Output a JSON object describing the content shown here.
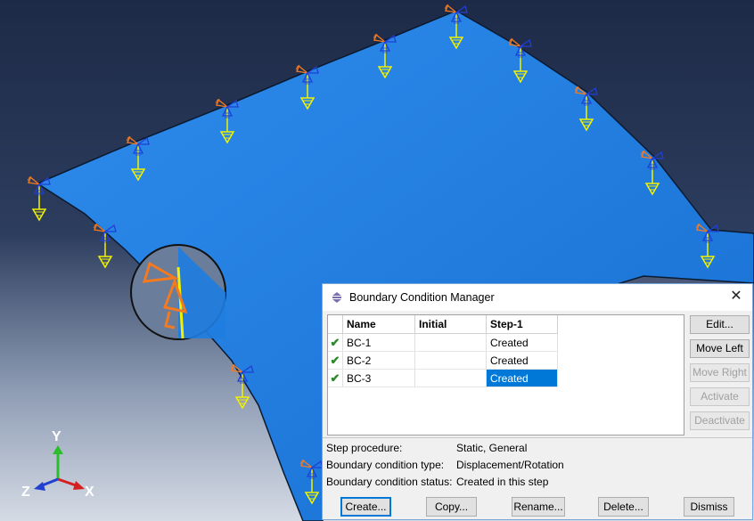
{
  "dialog": {
    "title": "Boundary Condition Manager",
    "close_label": "✕",
    "table": {
      "headers": [
        "Name",
        "Initial",
        "Step-1"
      ],
      "rows": [
        {
          "status": "✔",
          "name": "BC-1",
          "initial": "",
          "step1": "Created"
        },
        {
          "status": "✔",
          "name": "BC-2",
          "initial": "",
          "step1": "Created"
        },
        {
          "status": "✔",
          "name": "BC-3",
          "initial": "",
          "step1": "Created",
          "selected": true
        }
      ]
    },
    "side_buttons": {
      "edit": "Edit...",
      "move_left": "Move Left",
      "move_right": "Move Right",
      "activate": "Activate",
      "deactivate": "Deactivate"
    },
    "info": {
      "step_procedure_label": "Step procedure:",
      "step_procedure_value": "Static, General",
      "bc_type_label": "Boundary condition type:",
      "bc_type_value": "Displacement/Rotation",
      "bc_status_label": "Boundary condition status:",
      "bc_status_value": "Created in this step"
    },
    "bottom_buttons": {
      "create": "Create...",
      "copy": "Copy...",
      "rename": "Rename...",
      "delete": "Delete...",
      "dismiss": "Dismiss"
    }
  },
  "triad": {
    "y": "Y",
    "z": "Z",
    "x": "X"
  },
  "colors": {
    "background_top": "#1e2c4a",
    "background_bottom": "#cfd7e3",
    "part_fill": "#1f7de0",
    "constraint_orange": "#f47a20",
    "constraint_blue": "#1f3fd6",
    "load_yellow": "#f2f200",
    "selection_blue": "#0078d7"
  }
}
